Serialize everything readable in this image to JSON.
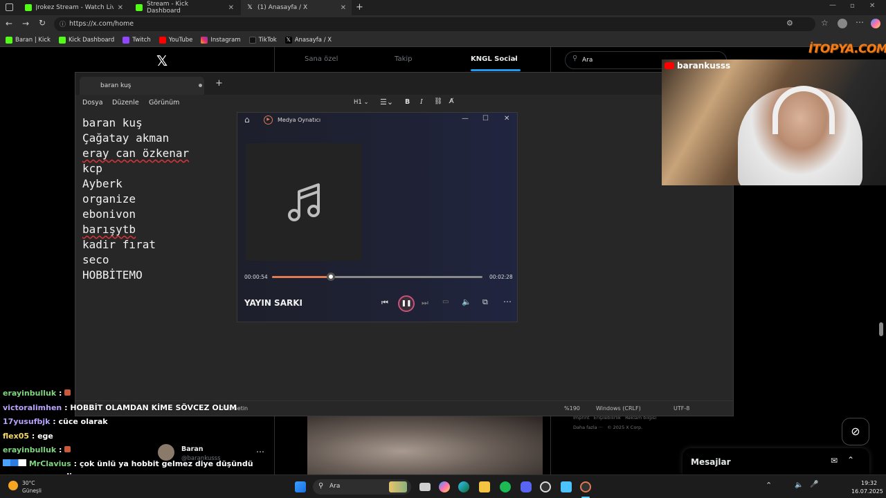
{
  "browser": {
    "tabs": [
      {
        "title": "Jrokez Stream - Watch Live on Ki"
      },
      {
        "title": "Stream - Kick Dashboard"
      },
      {
        "title": "(1) Anasayfa / X"
      }
    ],
    "url": "https://x.com/home",
    "bookmarks": [
      "Baran | Kick",
      "Kick Dashboard",
      "Twitch",
      "YouTube",
      "Instagram",
      "TikTok",
      "Anasayfa / X"
    ]
  },
  "x": {
    "tabs": [
      "Sana özel",
      "Takip",
      "KNGL Social"
    ],
    "search_placeholder": "Ara",
    "footer1": "Imprint   Erişilebilirlik   Reklam bilgisi",
    "footer2": "Daha fazla ···   © 2025 X Corp.",
    "messages_label": "Mesajlar",
    "profile_name": "Baran",
    "profile_handle": "@barankusss"
  },
  "notepad": {
    "tab_title": "baran kuş",
    "menu": [
      "Dosya",
      "Düzenle",
      "Görünüm"
    ],
    "heading_label": "H1",
    "lines": [
      "baran kuş",
      "Çağatay akman",
      "eray can özkenar",
      "kcp",
      "Ayberk",
      "organize",
      "ebonivon",
      "barışytb",
      "kadir fırat",
      "seco",
      "HOBBİTEMO"
    ],
    "status": {
      "mode": "Düz metin",
      "zoom": "%190",
      "eol": "Windows (CRLF)",
      "encoding": "UTF-8"
    }
  },
  "player": {
    "title": "Medya Oynatıcı",
    "elapsed": "00:00:54",
    "total": "00:02:28",
    "progress": 0.28,
    "track_name": "YAYIN SARKI"
  },
  "overlay": {
    "channel": "barankusss",
    "watermark": "İTOPYA.COM"
  },
  "chat": [
    {
      "user": "erayinbulluk",
      "color": "#7fd67f",
      "text": ""
    },
    {
      "user": "victoralimhen",
      "color": "#b9a3ff",
      "text": "HOBBİT OLAMDAN KİME SÖVCEZ OLUM"
    },
    {
      "user": "17yusufbjk",
      "color": "#b9a3ff",
      "text": "cüce olarak"
    },
    {
      "user": "flex05",
      "color": "#f5d76e",
      "text": "ege"
    },
    {
      "user": "erayinbulluk",
      "color": "#7fd67f",
      "text": ""
    },
    {
      "user": "MrClavius",
      "color": "#7fd67f",
      "text": "çok ünlü ya hobbit gelmez diye düşündü"
    },
    {
      "user": "",
      "color": "#ffffff",
      "text": "yazmasam mı diye"
    }
  ],
  "taskbar": {
    "weather_temp": "30°C",
    "weather_desc": "Güneşli",
    "search_label": "Ara",
    "time": "19:32",
    "date": "16.07.2025"
  }
}
